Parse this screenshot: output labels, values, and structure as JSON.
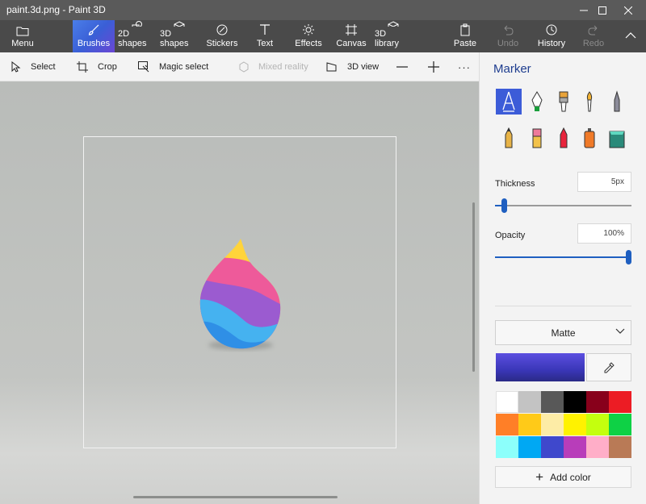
{
  "window": {
    "title": "paint.3d.png - Paint 3D",
    "minimize_glyph": "—",
    "maximize_glyph": "☐",
    "close_glyph": "✕"
  },
  "ribbon": {
    "menu": "Menu",
    "brushes": "Brushes",
    "shapes_2d": "2D shapes",
    "shapes_3d": "3D shapes",
    "stickers": "Stickers",
    "text": "Text",
    "effects": "Effects",
    "canvas": "Canvas",
    "library_3d": "3D library",
    "paste": "Paste",
    "undo": "Undo",
    "history": "History",
    "redo": "Redo"
  },
  "toolbar": {
    "select": "Select",
    "crop": "Crop",
    "magic_select": "Magic select",
    "mixed_reality": "Mixed reality",
    "view_3d": "3D view",
    "zoom_out": "—",
    "zoom_in": "+",
    "more": "···"
  },
  "panel": {
    "title": "Marker",
    "brushes": [
      {
        "name": "marker",
        "selected": true
      },
      {
        "name": "calligraphy-pen"
      },
      {
        "name": "oil-brush"
      },
      {
        "name": "watercolor"
      },
      {
        "name": "pixel-pen"
      },
      {
        "name": "pencil"
      },
      {
        "name": "eraser"
      },
      {
        "name": "crayon"
      },
      {
        "name": "spray-can"
      },
      {
        "name": "fill-bucket"
      }
    ],
    "thickness_label": "Thickness",
    "thickness_value": "5px",
    "thickness_fraction": 0.05,
    "opacity_label": "Opacity",
    "opacity_value": "100%",
    "opacity_fraction": 1.0,
    "finish": "Matte",
    "current_color": "#3f3bc6",
    "palette": [
      "#ffffff",
      "#c3c3c3",
      "#585858",
      "#000000",
      "#88001b",
      "#ec1c24",
      "#ff7f27",
      "#ffca18",
      "#fdeca6",
      "#fff200",
      "#c4ff0e",
      "#0ed145",
      "#8cfffb",
      "#00a8f3",
      "#3f48cc",
      "#b83dba",
      "#ffaec8",
      "#b97a56"
    ],
    "add_color": "Add color"
  },
  "colors": {
    "accent": "#3c5cd8",
    "title_blue": "#1e3d8f"
  }
}
